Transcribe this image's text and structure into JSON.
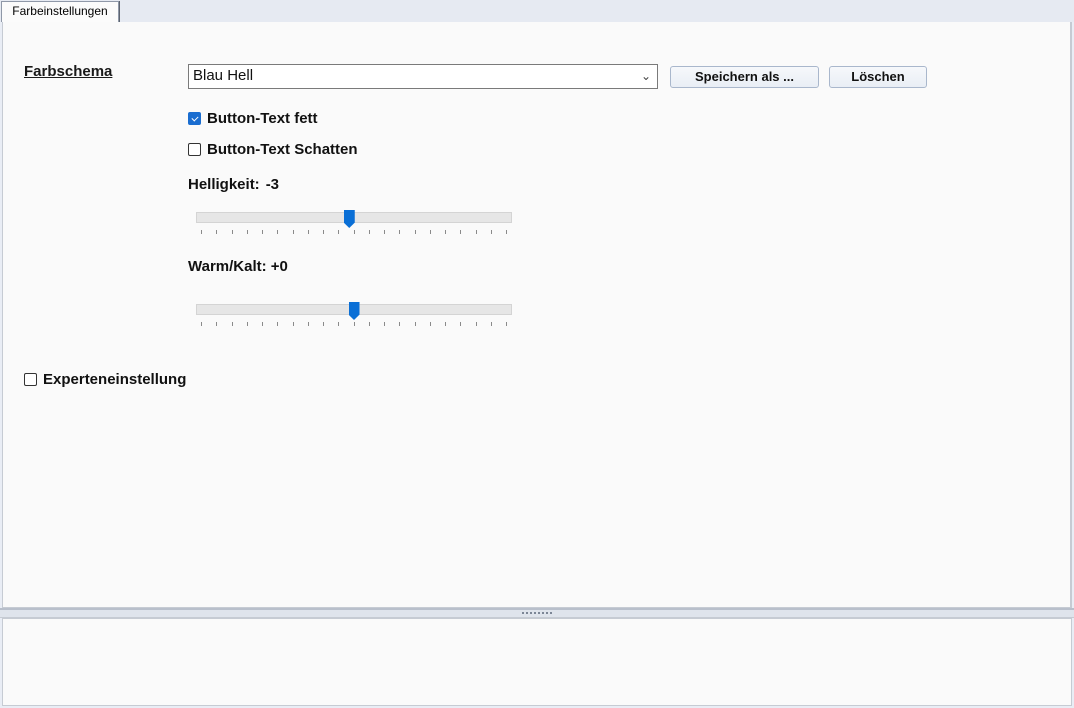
{
  "tabs": [
    {
      "label": "Farbeinstellungen",
      "active": true
    }
  ],
  "farbschema": {
    "label": "Farbschema",
    "selected": "Blau Hell",
    "save_button": "Speichern als ...",
    "delete_button": "Löschen"
  },
  "options": {
    "bold_text": {
      "label": "Button-Text fett",
      "checked": true
    },
    "text_shadow": {
      "label": "Button-Text Schatten",
      "checked": false
    }
  },
  "helligkeit": {
    "label": "Helligkeit:",
    "value": "-3",
    "position_fraction": 0.485
  },
  "warm_kalt": {
    "label": "Warm/Kalt:",
    "value": "+0",
    "position_fraction": 0.5
  },
  "expert": {
    "label": "Experteneinstellung",
    "checked": false
  },
  "colors": {
    "accent": "#0a6fd6",
    "panel_bg": "#fafafa",
    "chrome_bg": "#e6eaf2"
  }
}
